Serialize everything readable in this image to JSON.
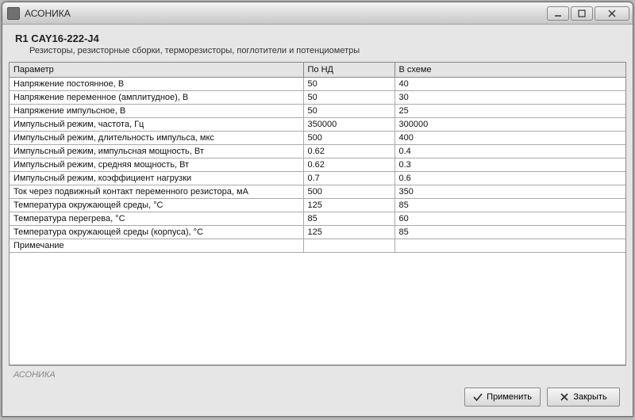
{
  "window": {
    "title": "АСОНИКА"
  },
  "header": {
    "title": "R1 CAY16-222-J4",
    "subtitle": "Резисторы, резисторные сборки, терморезисторы, поглотители и потенциометры"
  },
  "grid": {
    "columns": {
      "param": "Параметр",
      "nd": "По НД",
      "scheme": "В схеме"
    },
    "rows": [
      {
        "param": "Напряжение постоянное, В",
        "nd": "50",
        "scheme": "40"
      },
      {
        "param": "Напряжение переменное (амплитудное), В",
        "nd": "50",
        "scheme": "30"
      },
      {
        "param": "Напряжение импульсное, В",
        "nd": "50",
        "scheme": "25"
      },
      {
        "param": "Импульсный режим, частота, Гц",
        "nd": "350000",
        "scheme": "300000"
      },
      {
        "param": "Импульсный режим, длительность импульса, мкс",
        "nd": "500",
        "scheme": "400"
      },
      {
        "param": "Импульсный режим, импульсная мощность, Вт",
        "nd": "0.62",
        "scheme": "0.4"
      },
      {
        "param": "Импульсный режим, средняя мощность, Вт",
        "nd": "0.62",
        "scheme": "0.3"
      },
      {
        "param": "Импульсный режим, коэффициент нагрузки",
        "nd": "0.7",
        "scheme": "0.6"
      },
      {
        "param": "Ток через подвижный контакт переменного резистора, мА",
        "nd": "500",
        "scheme": "350"
      },
      {
        "param": "Температура окружающей среды, °С",
        "nd": "125",
        "scheme": "85"
      },
      {
        "param": "Температура перегрева, °С",
        "nd": "85",
        "scheme": "60"
      },
      {
        "param": "Температура окружающей среды (корпуса), °С",
        "nd": "125",
        "scheme": "85"
      },
      {
        "param": "Примечание",
        "nd": "",
        "scheme": ""
      }
    ]
  },
  "statusbar": {
    "text": "АСОНИКА"
  },
  "buttons": {
    "apply": "Применить",
    "close": "Закрыть"
  }
}
